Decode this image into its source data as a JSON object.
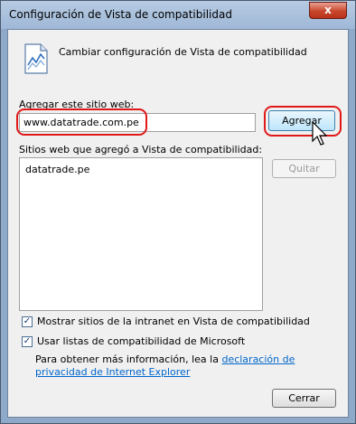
{
  "window": {
    "title": "Configuración de Vista de compatibilidad",
    "close_glyph": "x"
  },
  "header": {
    "text": "Cambiar configuración de Vista de compatibilidad",
    "icon": "document-chart-icon"
  },
  "add_site": {
    "label": "Agregar este sitio web:",
    "value": "www.datatrade.com.pe",
    "button_label": "Agregar"
  },
  "site_list": {
    "label": "Sitios web que agregó a Vista de compatibilidad:",
    "items": [
      "datatrade.pe"
    ],
    "remove_label": "Quitar"
  },
  "options": {
    "intranet_label": "Mostrar sitios de la intranet en Vista de compatibilidad",
    "intranet_checked": true,
    "mslists_label": "Usar listas de compatibilidad de Microsoft",
    "mslists_checked": true
  },
  "info": {
    "prefix": "Para obtener más información, lea la ",
    "link": "declaración de privacidad de Internet Explorer"
  },
  "footer": {
    "close_label": "Cerrar"
  },
  "colors": {
    "annotation": "#e01818",
    "link": "#0066cc"
  }
}
